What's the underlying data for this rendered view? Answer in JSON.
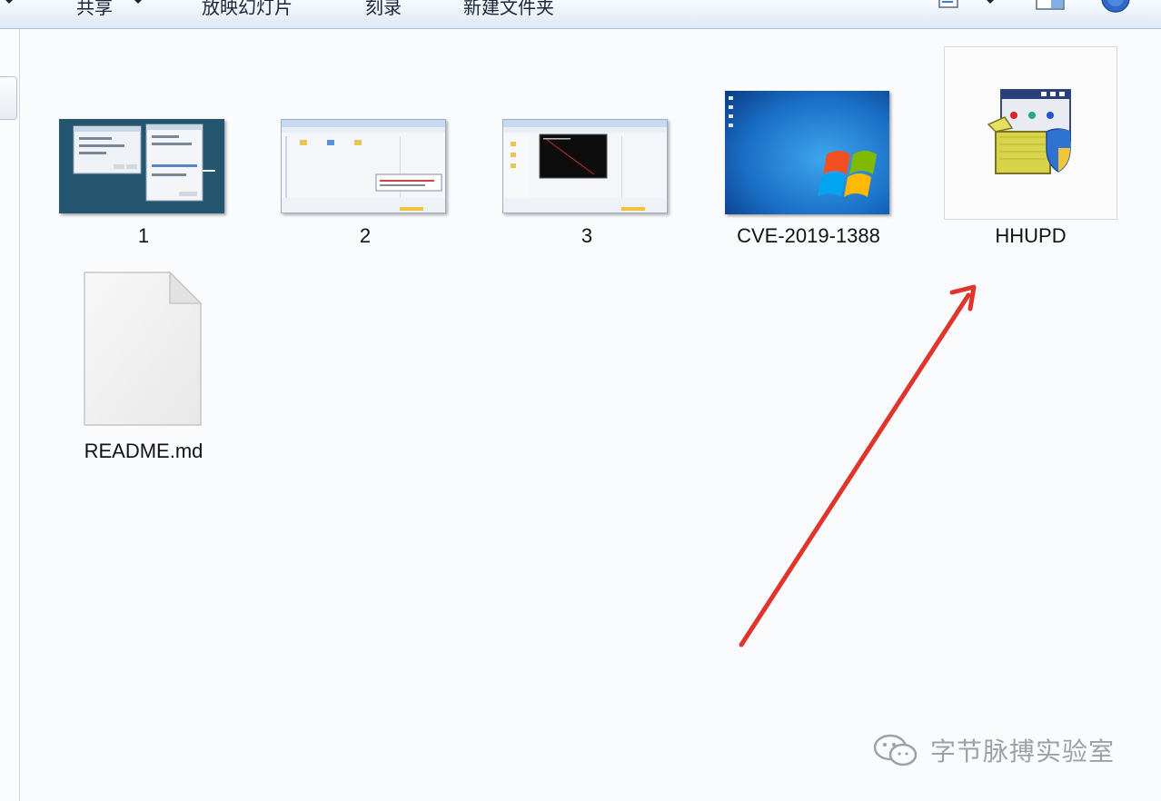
{
  "toolbar": {
    "share_label": "共享",
    "slideshow_label": "放映幻灯片",
    "burn_label": "刻录",
    "new_folder_label": "新建文件夹",
    "icons": [
      "view-options-icon",
      "preview-pane-icon",
      "help-icon"
    ]
  },
  "files": [
    {
      "name": "1",
      "type": "image-thumbnail"
    },
    {
      "name": "2",
      "type": "image-thumbnail"
    },
    {
      "name": "3",
      "type": "image-thumbnail"
    },
    {
      "name": "CVE-2019-1388",
      "type": "image-thumbnail"
    },
    {
      "name": "HHUPD",
      "type": "installer-executable",
      "selected": true
    },
    {
      "name": "README.md",
      "type": "blank-document"
    }
  ],
  "annotation": {
    "color": "#e0352b"
  },
  "watermark": {
    "text": "字节脉搏实验室"
  },
  "colors": {
    "toolbar_bg": "#dce8f6",
    "content_bg": "#fafbfd",
    "arrow": "#e0352b"
  }
}
